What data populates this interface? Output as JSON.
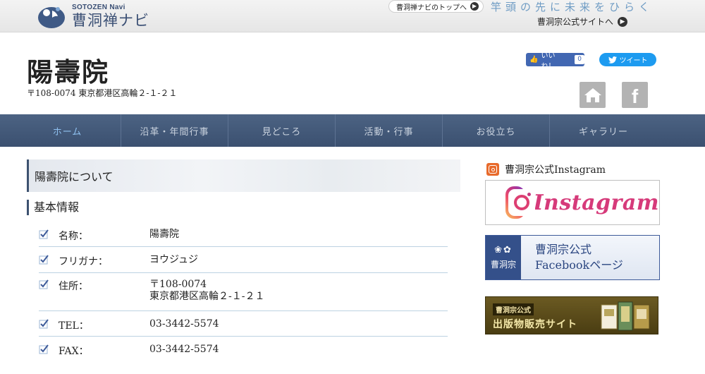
{
  "topbar": {
    "logo_small": "SOTOZEN Navi",
    "logo_big": "曹洞禅ナビ",
    "top_link": "曹洞禅ナビのトップへ",
    "tagline": "竿頭の先に未来をひらく",
    "official_link": "曹洞宗公式サイトへ"
  },
  "header": {
    "title": "陽壽院",
    "address": "〒108-0074  東京都港区高輪２-１-２１",
    "like_label": "いいね！",
    "like_count": "0",
    "tweet_label": "ツイート",
    "home_icon": "home-icon",
    "facebook_icon": "facebook-icon"
  },
  "nav": {
    "items": [
      {
        "label": "ホーム",
        "active": true
      },
      {
        "label": "沿革・年間行事"
      },
      {
        "label": "見どころ"
      },
      {
        "label": "活動・行事"
      },
      {
        "label": "お役立ち"
      },
      {
        "label": "ギャラリー"
      }
    ]
  },
  "main": {
    "section_title": "陽壽院について",
    "subhead": "基本情報",
    "rows": [
      {
        "label": "名称：",
        "value": "陽壽院"
      },
      {
        "label": "フリガナ：",
        "value": "ヨウジュジ"
      },
      {
        "label": "住所：",
        "value_line1": "〒108-0074",
        "value_line2": "東京都港区高輪２-１-２１"
      },
      {
        "label": "TEL：",
        "value": "03-3442-5574"
      },
      {
        "label": "FAX：",
        "value": "03-3442-5574"
      }
    ]
  },
  "sidebar": {
    "instagram_title": "曹洞宗公式Instagram",
    "instagram_word": "Instagram",
    "facebook_badge": "曹洞宗",
    "facebook_line1": "曹洞宗公式",
    "facebook_line2": "Facebookページ",
    "pub_top": "曹洞宗公式",
    "pub_main": "出版物販売サイト"
  },
  "colors": {
    "nav_bg": "#3b5070",
    "nav_active": "#8fc1f0",
    "accent": "#3d5270",
    "like_blue": "#4267b2",
    "tweet_blue": "#1d9bf0"
  }
}
